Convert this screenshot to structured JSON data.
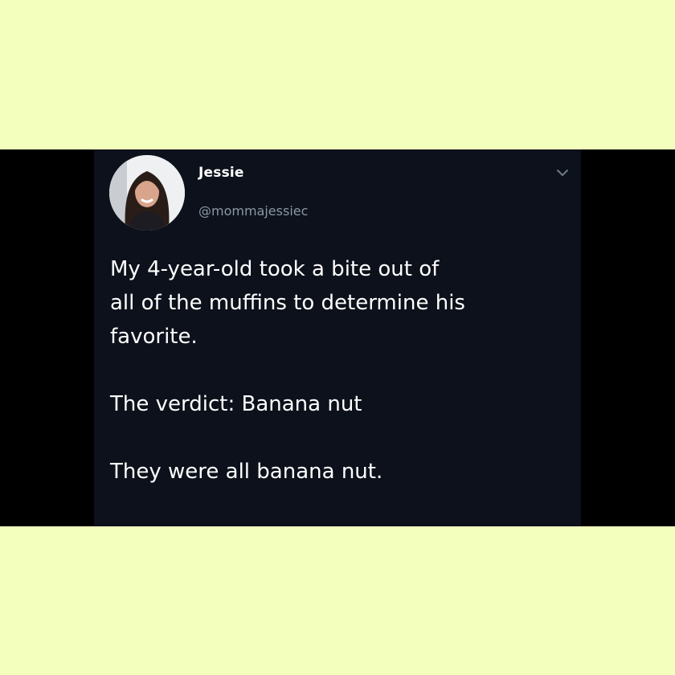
{
  "tweet": {
    "display_name": "Jessie",
    "handle": "@mommajessiec",
    "paragraphs": [
      "My 4-year-old took a bite out of\nall of the muffins to determine his\nfavorite.",
      "The verdict: Banana nut",
      "They were all banana nut."
    ],
    "menu_icon": "chevron-down-icon",
    "avatar_icon": "profile-photo"
  },
  "colors": {
    "background_frame": "#f2ffbd",
    "card_background": "#0c111b",
    "text_primary": "#ffffff",
    "text_secondary": "#8b98a5"
  }
}
